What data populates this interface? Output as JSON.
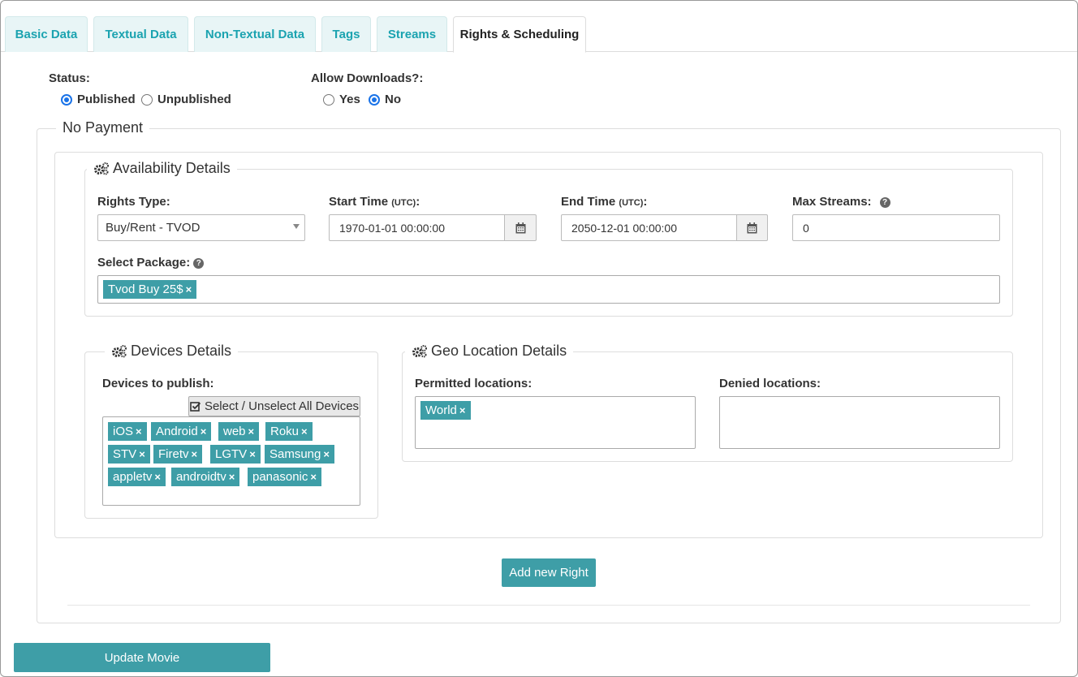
{
  "tabs": [
    {
      "label": "Basic Data"
    },
    {
      "label": "Textual Data"
    },
    {
      "label": "Non-Textual Data"
    },
    {
      "label": "Tags"
    },
    {
      "label": "Streams"
    },
    {
      "label": "Rights & Scheduling"
    }
  ],
  "active_tab": "Rights & Scheduling",
  "status": {
    "label": "Status:",
    "options": [
      "Published",
      "Unpublished"
    ],
    "selected": "Published"
  },
  "downloads": {
    "label": "Allow Downloads?:",
    "options": [
      "Yes",
      "No"
    ],
    "selected": "No"
  },
  "payment_section": {
    "title": "No Payment"
  },
  "availability": {
    "title": "Availability Details",
    "rights_type_label": "Rights Type:",
    "rights_type_value": "Buy/Rent - TVOD",
    "start_time_label": "Start Time",
    "start_time_utc": "(UTC)",
    "start_time_colon": ":",
    "start_time_value": "1970-01-01 00:00:00",
    "end_time_label": "End Time",
    "end_time_utc": "(UTC)",
    "end_time_colon": ":",
    "end_time_value": "2050-12-01 00:00:00",
    "max_streams_label": "Max Streams:",
    "max_streams_value": "0",
    "package_label": "Select Package:",
    "packages": [
      "Tvod Buy 25$"
    ]
  },
  "devices": {
    "title": "Devices Details",
    "publish_label": "Devices to publish:",
    "select_all_label": "Select / Unselect All Devices",
    "items": [
      "iOS",
      "Android",
      "web",
      "Roku",
      "STV",
      "Firetv",
      "LGTV",
      "Samsung",
      "appletv",
      "androidtv",
      "panasonic"
    ]
  },
  "geo": {
    "title": "Geo Location Details",
    "permitted_label": "Permitted locations:",
    "permitted": [
      "World"
    ],
    "denied_label": "Denied locations:",
    "denied": []
  },
  "add_right_label": "Add new Right",
  "update_label": "Update Movie",
  "tag_remove_glyph": "×",
  "help_glyph": "?",
  "colors": {
    "accent": "#3e9ea7",
    "tab_text": "#1ba3b0",
    "radio": "#1a73e8"
  }
}
